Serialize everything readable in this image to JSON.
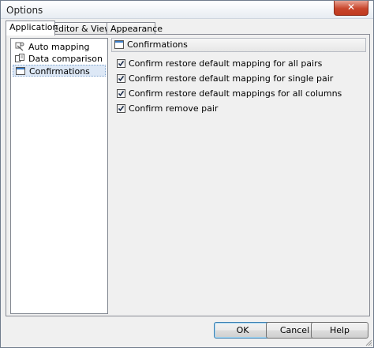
{
  "window": {
    "title": "Options",
    "close_glyph": "✕"
  },
  "tabs": [
    {
      "label": "Application",
      "active": true
    },
    {
      "label": "Editor & Viewers",
      "active": false
    },
    {
      "label": "Appearance",
      "active": false
    }
  ],
  "tree": {
    "items": [
      {
        "label": "Auto mapping",
        "icon": "auto-mapping-icon",
        "selected": false
      },
      {
        "label": "Data comparison",
        "icon": "data-comparison-icon",
        "selected": false
      },
      {
        "label": "Confirmations",
        "icon": "confirmations-icon",
        "selected": true
      }
    ]
  },
  "section": {
    "title": "Confirmations",
    "icon": "window-icon",
    "options": [
      {
        "label": "Confirm restore default mapping for all pairs",
        "checked": true
      },
      {
        "label": "Confirm restore default mapping for single pair",
        "checked": true
      },
      {
        "label": "Confirm restore default mappings for all columns",
        "checked": true
      },
      {
        "label": "Confirm remove pair",
        "checked": true
      }
    ]
  },
  "buttons": {
    "ok": "OK",
    "cancel": "Cancel",
    "help": "Help"
  },
  "colors": {
    "selection": "#dde8f6",
    "close": "#c8462c",
    "default_border": "#3c7fb1"
  }
}
